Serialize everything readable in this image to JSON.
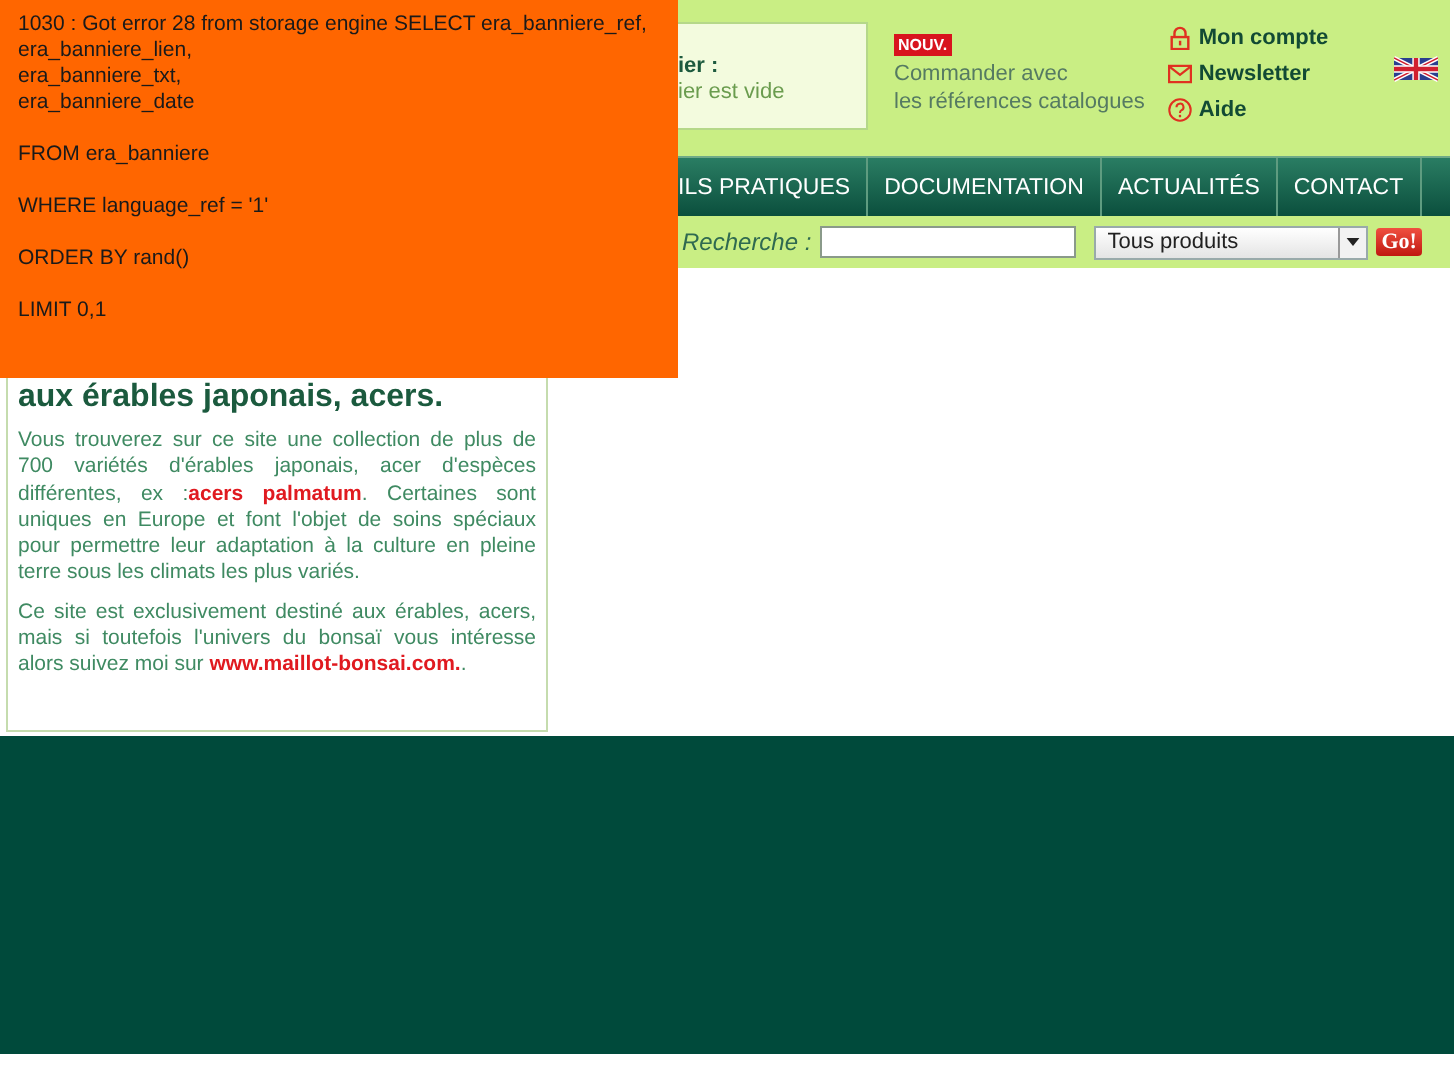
{
  "error_message": {
    "blocks": [
      [
        "1030 : Got error 28 from storage engine SELECT era_banniere_ref,",
        "era_banniere_lien,",
        "era_banniere_txt,",
        "era_banniere_date"
      ],
      [
        "FROM era_banniere"
      ],
      [
        "WHERE language_ref = '1'"
      ],
      [
        "ORDER BY rand()"
      ],
      [
        "LIMIT 0,1"
      ]
    ]
  },
  "header": {
    "cart": {
      "title": "ier :",
      "status": "ier est vide"
    },
    "promo": {
      "badge": "NOUV.",
      "lines": [
        "Commander avec",
        "les références catalogues"
      ]
    },
    "links": [
      {
        "label": "Mon compte",
        "kind": "account"
      },
      {
        "label": "Newsletter",
        "kind": "newsletter"
      },
      {
        "label": "Aide",
        "kind": "help"
      }
    ]
  },
  "nav": [
    "ILS PRATIQUES",
    "DOCUMENTATION",
    "ACTUALITÉS",
    "CONTACT"
  ],
  "search": {
    "label": "Recherche :",
    "category": "Tous produits",
    "button": "Go!"
  },
  "intro": {
    "heading": "aux érables japonais, acers.",
    "paragraph_1": "Vous trouverez sur ce site une collection de plus de 700 variétés d'érables japonais, acer d'espèces différentes, ex :**acers palmatum**. Certaines sont uniques en Europe et font l'objet de soins spéciaux pour permettre leur adaptation à la culture en pleine terre sous les climats les plus variés.",
    "paragraph_2": "Ce site est exclusivement destiné aux érables, acers, mais si toutefois l'univers du bonsaï vous intéresse alors suivez moi sur ",
    "link": "www.maillot-bonsai.com.",
    "paragraph_2_end": "."
  }
}
